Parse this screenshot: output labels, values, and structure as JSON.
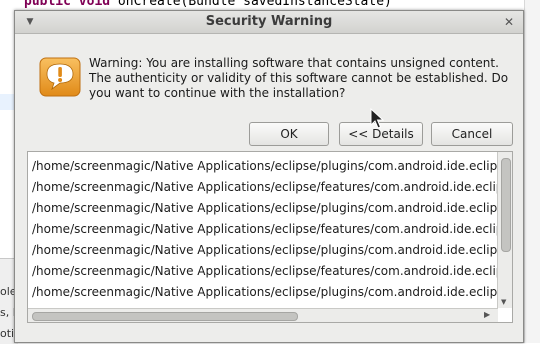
{
  "background": {
    "code_keywords": "public void",
    "code_rest": " onCreate(Bundle savedInstanceState)",
    "fragments": [
      "ole",
      "s, I",
      "otio."
    ]
  },
  "dialog": {
    "title": "Security Warning",
    "message": "Warning: You are installing software that contains unsigned content. The authenticity or validity of this software cannot be established. Do you want to continue with the installation?",
    "icon": "warning-speech-bubble-icon",
    "buttons": {
      "ok": "OK",
      "details": "<< Details",
      "cancel": "Cancel"
    },
    "details_list": [
      "/home/screenmagic/Native Applications/eclipse/plugins/com.android.ide.eclipse.adt",
      "/home/screenmagic/Native Applications/eclipse/features/com.android.ide.eclipse.adt",
      "/home/screenmagic/Native Applications/eclipse/plugins/com.android.ide.eclipse.adt",
      "/home/screenmagic/Native Applications/eclipse/features/com.android.ide.eclipse.ddms",
      "/home/screenmagic/Native Applications/eclipse/plugins/com.android.ide.eclipse.hierarchyviewer",
      "/home/screenmagic/Native Applications/eclipse/features/com.android.ide.eclipse.hierarchyviewer",
      "/home/screenmagic/Native Applications/eclipse/plugins/com.android.ide.eclipse.traceview"
    ]
  },
  "colors": {
    "accent_icon": "#f0a032",
    "dialog_bg": "#ededeb"
  }
}
